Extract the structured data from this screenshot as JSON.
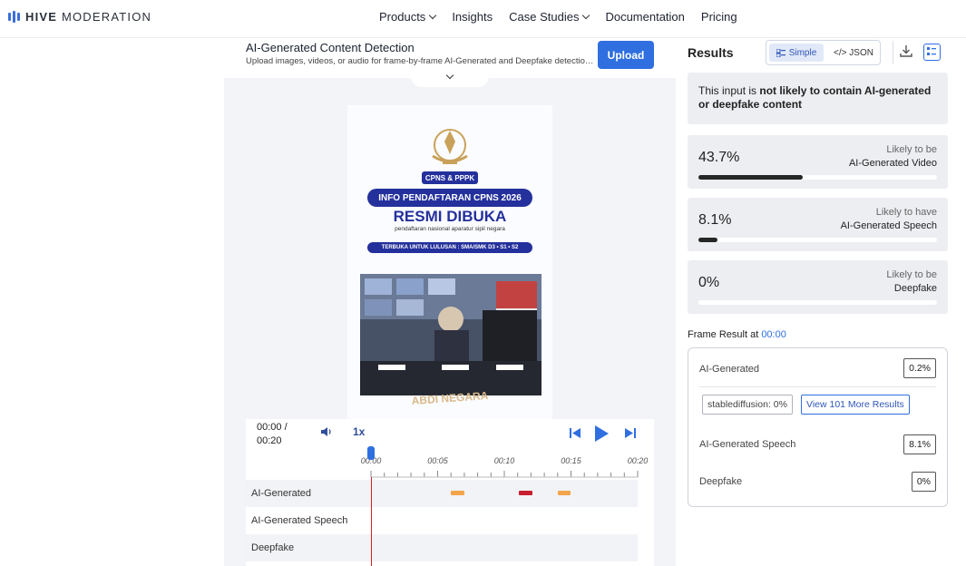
{
  "brand": {
    "name_bold": "HIVE",
    "name_rest": " MODERATION",
    "color": "#3b6fd6",
    "logo_icon": "hive-bars-icon"
  },
  "nav": {
    "items": [
      {
        "label": "Products",
        "dropdown": true
      },
      {
        "label": "Insights",
        "dropdown": false
      },
      {
        "label": "Case Studies",
        "dropdown": true
      },
      {
        "label": "Documentation",
        "dropdown": false
      },
      {
        "label": "Pricing",
        "dropdown": false
      }
    ]
  },
  "tool": {
    "title": "AI-Generated Content Detection",
    "subtitle": "Upload images, videos, or audio for frame-by-frame AI-Generated and Deepfake detection with...",
    "upload_label": "Upload"
  },
  "media": {
    "badge": "CPNS & PPPK",
    "info": "INFO PENDAFTARAN CPNS 2026",
    "headline": "RESMI DIBUKA",
    "subline": "pendaftaran nasional aparatur sipil negara",
    "terbuka": "TERBUKA UNTUK LULUSAN : SMA/SMK D3 • S1 • S2",
    "watermark": "ABDI NEGARA"
  },
  "player": {
    "current_time": "00:00 /",
    "duration": "00:20",
    "rate": "1x",
    "playhead_time_sec": 0,
    "timeline_max_sec": 20,
    "ticks": [
      "00:00",
      "00:05",
      "00:10",
      "00:15",
      "00:20"
    ],
    "tracks": [
      {
        "label": "AI-Generated",
        "segments": [
          {
            "start": 6.0,
            "end": 7.0,
            "color": "#f3a54a"
          },
          {
            "start": 11.1,
            "end": 12.1,
            "color": "#c81e2f"
          },
          {
            "start": 14.0,
            "end": 15.0,
            "color": "#f3a54a"
          }
        ]
      },
      {
        "label": "AI-Generated Speech",
        "segments": []
      },
      {
        "label": "Deepfake",
        "segments": []
      }
    ],
    "accent": "#2f6fe0",
    "playhead_color": "#d81e2a"
  },
  "results": {
    "title": "Results",
    "view_simple": "Simple",
    "view_json": "</> JSON",
    "verdict_prefix": "This input is ",
    "verdict_bold": "not likely to contain AI-generated or deepfake content",
    "metrics": [
      {
        "value": "43.7%",
        "fraction": 0.437,
        "line1": "Likely to be",
        "line2": "AI-Generated Video"
      },
      {
        "value": "8.1%",
        "fraction": 0.081,
        "line1": "Likely to have",
        "line2": "AI-Generated Speech"
      },
      {
        "value": "0%",
        "fraction": 0.0,
        "line1": "Likely to be",
        "line2": "Deepfake"
      }
    ],
    "frame_title": "Frame Result at ",
    "frame_time": "00:00",
    "frame": {
      "ai_label": "AI-Generated",
      "ai_value": "0.2%",
      "chip_sd": "stablediffusion: 0%",
      "chip_more": "View 101 More Results",
      "speech_label": "AI-Generated Speech",
      "speech_value": "8.1%",
      "deepfake_label": "Deepfake",
      "deepfake_value": "0%"
    }
  }
}
